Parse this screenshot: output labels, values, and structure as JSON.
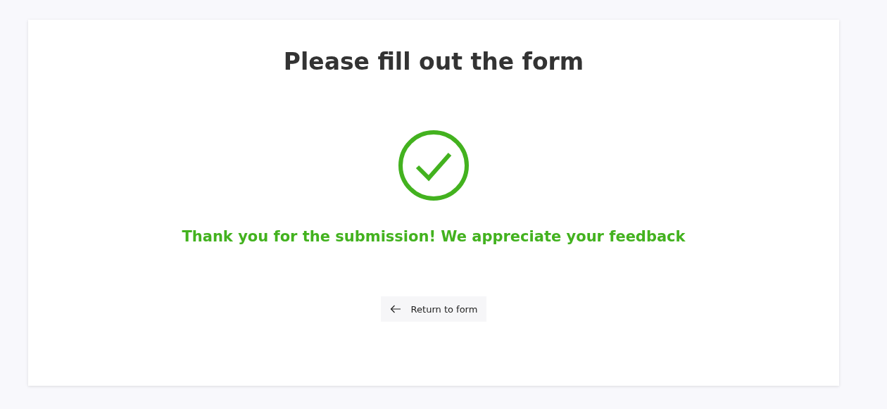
{
  "title": "Please fill out the form",
  "confirmation": {
    "kind": "success",
    "message": "Thank you for the submission! We appreciate your feedback"
  },
  "return_button": {
    "label": "Return to form"
  }
}
